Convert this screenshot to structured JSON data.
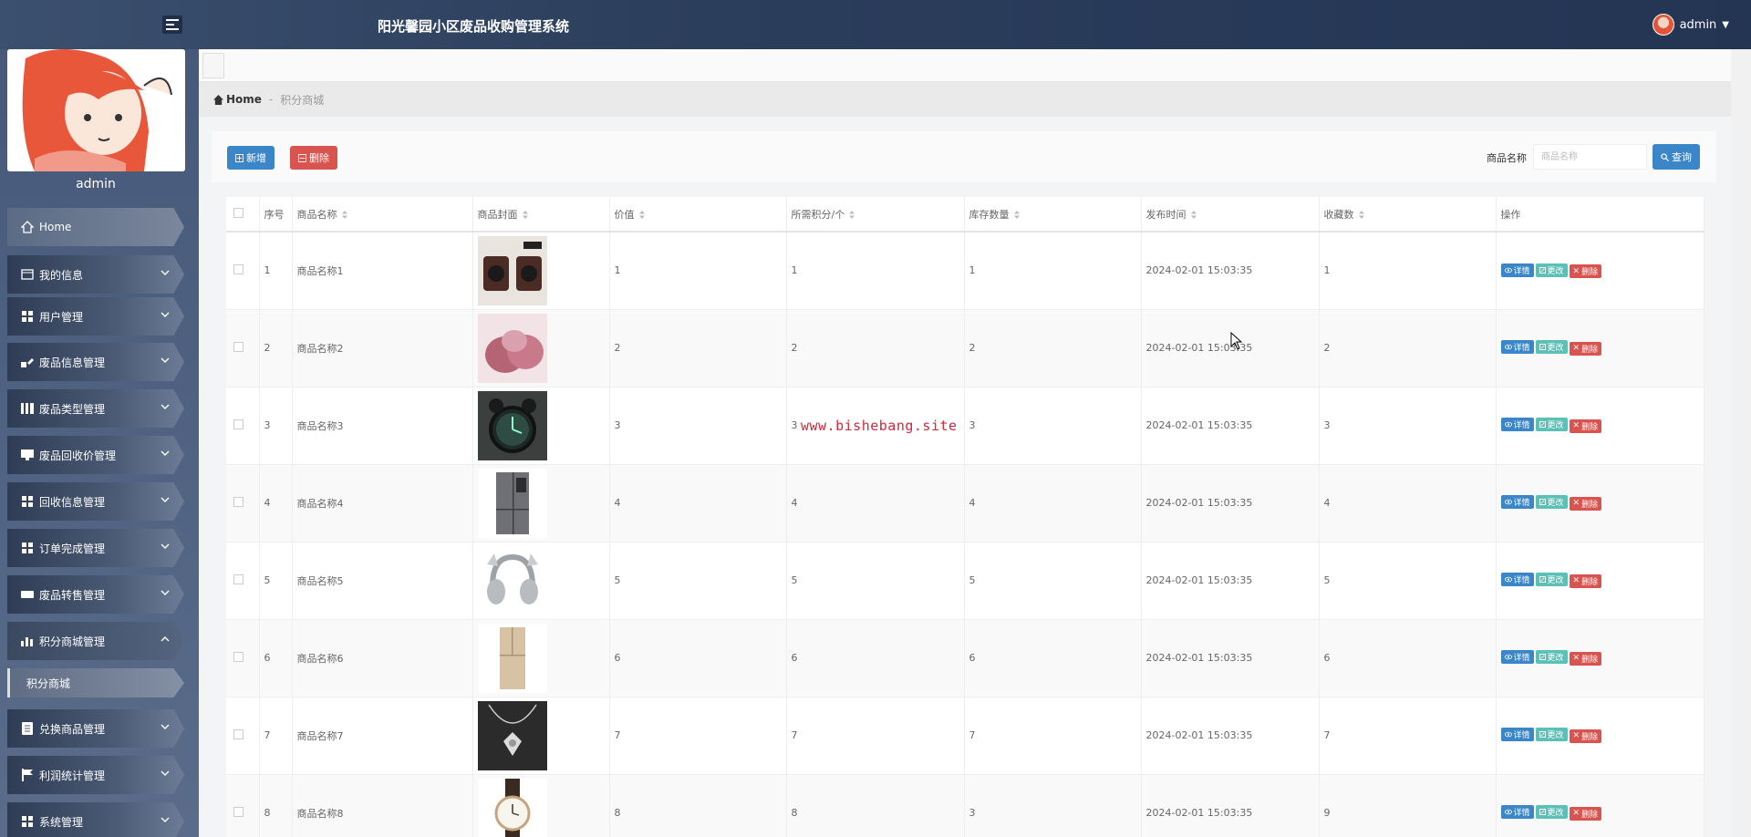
{
  "header": {
    "app_title": "阳光馨园小区废品收购管理系统",
    "user_name": "admin"
  },
  "sidebar": {
    "profile_name": "admin",
    "items": [
      {
        "label": "Home",
        "icon": "home-icon"
      },
      {
        "label": "我的信息",
        "icon": "card-icon"
      },
      {
        "label": "用户管理",
        "icon": "grid-icon"
      },
      {
        "label": "废品信息管理",
        "icon": "pencil-icon"
      },
      {
        "label": "废品类型管理",
        "icon": "columns-icon"
      },
      {
        "label": "废品回收价管理",
        "icon": "monitor-icon"
      },
      {
        "label": "回收信息管理",
        "icon": "grid-icon"
      },
      {
        "label": "订单完成管理",
        "icon": "grid-icon"
      },
      {
        "label": "废品转售管理",
        "icon": "hdd-icon"
      },
      {
        "label": "积分商城管理",
        "icon": "bar-chart-icon"
      },
      {
        "label": "兑换商品管理",
        "icon": "list-icon"
      },
      {
        "label": "利润统计管理",
        "icon": "flag-icon"
      },
      {
        "label": "系统管理",
        "icon": "grid-icon"
      }
    ],
    "sub_item": "积分商城"
  },
  "breadcrumb": {
    "home": "Home",
    "separator": "-",
    "current": "积分商城"
  },
  "toolbar": {
    "add_label": "新增",
    "delete_label": "删除",
    "search_label": "商品名称",
    "search_placeholder": "商品名称",
    "search_button": "查询"
  },
  "table": {
    "headers": [
      "序号",
      "商品名称",
      "商品封面",
      "价值",
      "所需积分/个",
      "库存数量",
      "发布时间",
      "收藏数",
      "操作"
    ],
    "action_labels": {
      "detail": "详情",
      "edit": "更改",
      "remove": "删除"
    },
    "rows": [
      {
        "no": "1",
        "name": "商品名称1",
        "image": "speakers",
        "value": "1",
        "points": "1",
        "stock": "1",
        "time": "2024-02-01 15:03:35",
        "favs": "1"
      },
      {
        "no": "2",
        "name": "商品名称2",
        "image": "onion",
        "value": "2",
        "points": "2",
        "stock": "2",
        "time": "2024-02-01 15:03:35",
        "favs": "2"
      },
      {
        "no": "3",
        "name": "商品名称3",
        "image": "alarm-clock",
        "value": "3",
        "points": "3",
        "stock": "3",
        "time": "2024-02-01 15:03:35",
        "favs": "3"
      },
      {
        "no": "4",
        "name": "商品名称4",
        "image": "fridge-dark",
        "value": "4",
        "points": "4",
        "stock": "4",
        "time": "2024-02-01 15:03:35",
        "favs": "4"
      },
      {
        "no": "5",
        "name": "商品名称5",
        "image": "headphones",
        "value": "5",
        "points": "5",
        "stock": "5",
        "time": "2024-02-01 15:03:35",
        "favs": "5"
      },
      {
        "no": "6",
        "name": "商品名称6",
        "image": "fridge-gold",
        "value": "6",
        "points": "6",
        "stock": "6",
        "time": "2024-02-01 15:03:35",
        "favs": "6"
      },
      {
        "no": "7",
        "name": "商品名称7",
        "image": "necklace",
        "value": "7",
        "points": "7",
        "stock": "7",
        "time": "2024-02-01 15:03:35",
        "favs": "7"
      },
      {
        "no": "8",
        "name": "商品名称8",
        "image": "watch",
        "value": "8",
        "points": "8",
        "stock": "3",
        "time": "2024-02-01 15:03:35",
        "favs": "9"
      }
    ]
  },
  "watermark": "www.bishebang.site",
  "colors": {
    "primary": "#3a86c8",
    "danger": "#d9534f",
    "success": "#5bc0b6",
    "header": "#2b3e5c"
  }
}
